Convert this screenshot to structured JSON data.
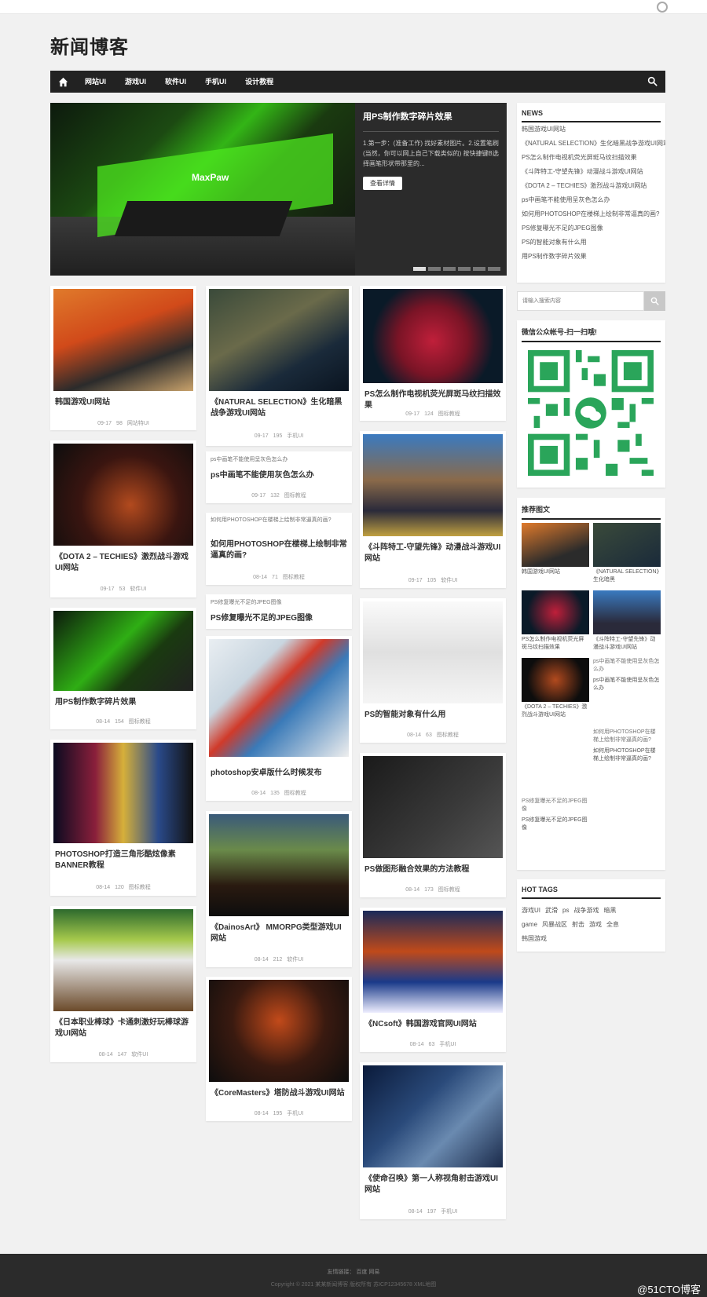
{
  "site_title": "新闻博客",
  "nav": {
    "items": [
      "网站UI",
      "游戏UI",
      "软件UI",
      "手机UI",
      "设计教程"
    ]
  },
  "slider": {
    "title": "用PS制作数字碎片效果",
    "desc": "1.第一步：(准备工作) 找好素材图片。2.设置笔刷(当然，你可以网上自己下载类似的) 按快捷键B选择画笔形状带那里的...",
    "button": "查看详情",
    "logo_text": "MaxPaw"
  },
  "cards": [
    {
      "title": "韩国游戏UI网站",
      "date": "09-17",
      "views": "98",
      "cat": "网站特UI"
    },
    {
      "title": "《DOTA 2 – TECHIES》激烈战斗游戏UI网站",
      "date": "09-17",
      "views": "53",
      "cat": "软件UI"
    },
    {
      "title": "用PS制作数字碎片效果",
      "date": "08-14",
      "views": "154",
      "cat": "图标教程"
    },
    {
      "title": "PHOTOSHOP打造三角形酷炫像素BANNER教程",
      "date": "08-14",
      "views": "120",
      "cat": "图标教程"
    },
    {
      "title": "《日本职业棒球》卡通刺激好玩棒球游戏UI网站",
      "date": "08-14",
      "views": "147",
      "cat": "软件UI"
    },
    {
      "title": "《NATURAL SELECTION》生化暗黑战争游戏UI网站",
      "date": "09-17",
      "views": "195",
      "cat": "手机UI"
    },
    {
      "title": "ps中画笔不能使用灰色怎么办",
      "alt": "ps中画笔不能使用呈灰色怎么办",
      "date": "09-17",
      "views": "132",
      "cat": "图标教程"
    },
    {
      "title": "如何用PHOTOSHOP在楼梯上绘制非常逼真的画?",
      "alt": "如何用PHOTOSHOP在楼梯上绘制非常逼真的画?",
      "date": "08-14",
      "views": "71",
      "cat": "图标教程"
    },
    {
      "title": "PS修复曝光不足的JPEG图像",
      "alt": "PS修复曝光不足的JPEG图像"
    },
    {
      "title": "photoshop安卓版什么时候发布",
      "date": "08-14",
      "views": "135",
      "cat": "图标教程"
    },
    {
      "title": "《DainosArt》 MMORPG类型游戏UI网站",
      "date": "08-14",
      "views": "212",
      "cat": "软件UI"
    },
    {
      "title": "《CoreMasters》塔防战斗游戏UI网站",
      "date": "08-14",
      "views": "195",
      "cat": "手机UI"
    },
    {
      "title": "PS怎么制作电视机荧光屏斑马纹扫描效果",
      "date": "09-17",
      "views": "124",
      "cat": "图标教程"
    },
    {
      "title": "《斗阵特工-守望先锋》动漫战斗游戏UI网站",
      "date": "09-17",
      "views": "105",
      "cat": "软件UI"
    },
    {
      "title": "PS的智能对象有什么用",
      "date": "08-14",
      "views": "63",
      "cat": "图标教程"
    },
    {
      "title": "PS做图形融合效果的方法教程",
      "date": "08-14",
      "views": "173",
      "cat": "图标教程"
    },
    {
      "title": "《NCsoft》韩国游戏官网UI网站",
      "date": "08-14",
      "views": "63",
      "cat": "手机UI"
    },
    {
      "title": "《使命召唤》第一人称视角射击游戏UI网站",
      "date": "08-14",
      "views": "197",
      "cat": "手机UI"
    }
  ],
  "sidebar": {
    "news_title": "NEWS",
    "news": [
      "韩国游戏UI网站",
      "《NATURAL SELECTION》生化暗黑战争游戏UI网站",
      "PS怎么制作电视机荧光屏斑马纹扫描效果",
      "《斗阵特工-守望先锋》动漫战斗游戏UI网站",
      "《DOTA 2 – TECHIES》激烈战斗游戏UI网站",
      "ps中画笔不能使用呈灰色怎么办",
      "如何用PHOTOSHOP在楼梯上绘制非常逼真的画?",
      "PS修复曝光不足的JPEG图像",
      "PS的智能对象有什么用",
      "用PS制作数字碎片效果"
    ],
    "search_placeholder": "请输入搜索内容",
    "wechat_title": "微信公众帐号-扫一扫哦!",
    "rec_title": "推荐图文",
    "rec": [
      "韩国游戏UI网站",
      "《NATURAL SELECTION》生化暗黑",
      "PS怎么制作电视机荧光屏斑马纹扫描效果",
      "《斗阵特工-守望先锋》动漫战斗游戏UI网站",
      "《DOTA 2 – TECHIES》激烈战斗游戏UI网站",
      "ps中画笔不能使用呈灰色怎么办",
      "如何用PHOTOSHOP在楼梯上绘制非常逼真的画?",
      "PS修复曝光不足的JPEG图像"
    ],
    "rec_alt": [
      "ps中画笔不能使用呈灰色怎么办",
      "如何用PHOTOSHOP在楼梯上绘制非常逼真的画?",
      "PS修复曝光不足的JPEG图像"
    ],
    "tags_title": "HOT TAGS",
    "tags": [
      "游戏UI",
      "武滑",
      "ps",
      "战争游戏",
      "暗黑",
      "game",
      "风暴战区",
      "射击",
      "游戏",
      "全息",
      "韩国游戏"
    ]
  },
  "footer": {
    "links": "友情链接：  百度  网易",
    "copyright": "Copyright © 2021 某某新闻博客 版权所有 苏ICP12345678 XML地图"
  },
  "watermark": "@51CTO博客"
}
